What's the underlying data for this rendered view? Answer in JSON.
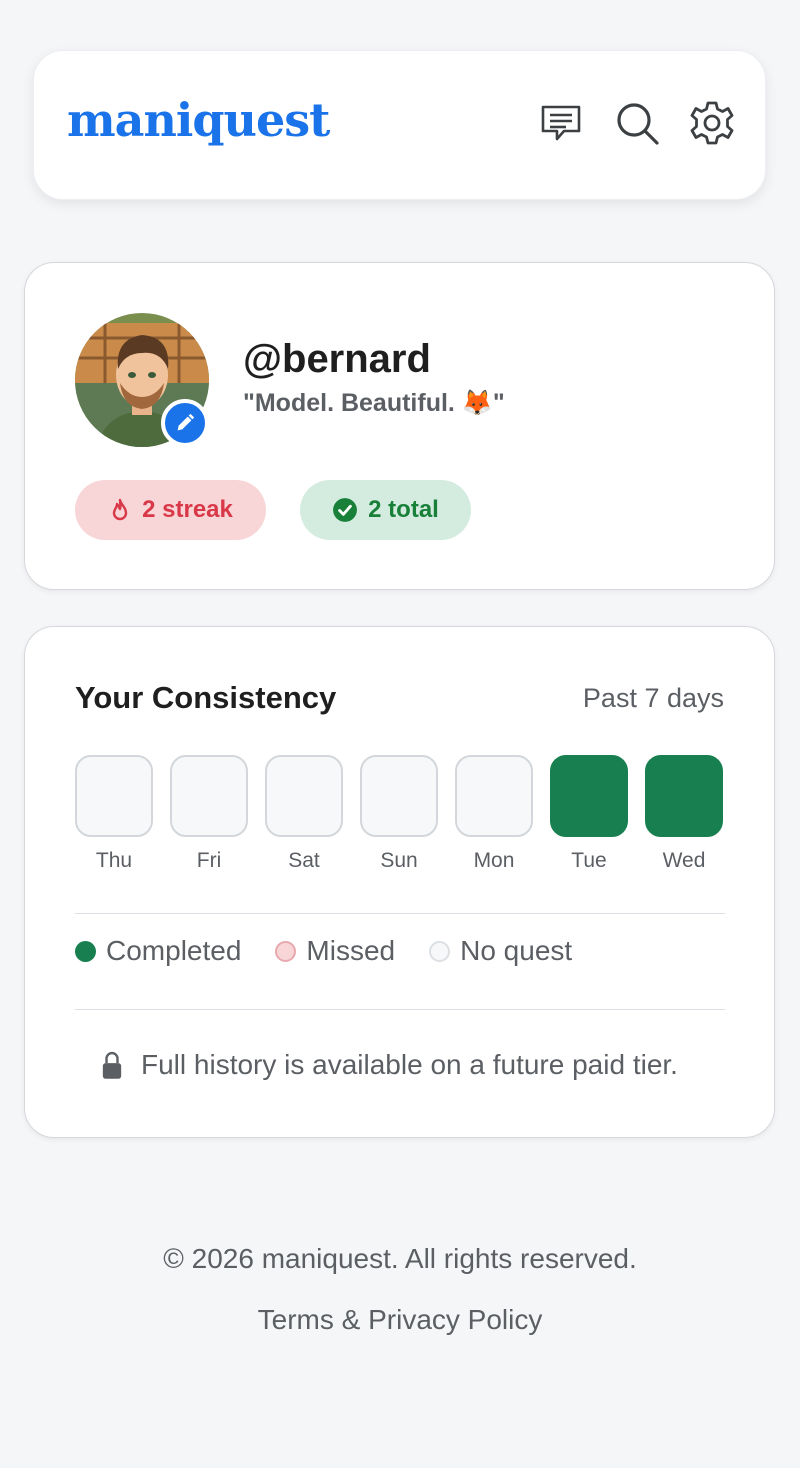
{
  "header": {
    "logo": "maniquest",
    "icons": [
      "chat-icon",
      "search-icon",
      "gear-icon"
    ]
  },
  "profile": {
    "username": "@bernard",
    "bio": "\"Model. Beautiful. 🦊\"",
    "streak_label": "2 streak",
    "total_label": "2 total"
  },
  "consistency": {
    "title": "Your Consistency",
    "range": "Past 7 days",
    "days": [
      {
        "label": "Thu",
        "status": "none"
      },
      {
        "label": "Fri",
        "status": "none"
      },
      {
        "label": "Sat",
        "status": "none"
      },
      {
        "label": "Sun",
        "status": "none"
      },
      {
        "label": "Mon",
        "status": "none"
      },
      {
        "label": "Tue",
        "status": "completed"
      },
      {
        "label": "Wed",
        "status": "completed"
      }
    ],
    "legend": {
      "completed": "Completed",
      "missed": "Missed",
      "no_quest": "No quest"
    },
    "note": "Full history is available on a future paid tier."
  },
  "footer": {
    "copyright": "© 2026 maniquest. All rights reserved.",
    "terms": "Terms & Privacy Policy"
  },
  "colors": {
    "brand": "#1a73e8",
    "completed": "#188050",
    "missed": "#f8d6d8",
    "streak": "#d93848",
    "total": "#188038"
  }
}
